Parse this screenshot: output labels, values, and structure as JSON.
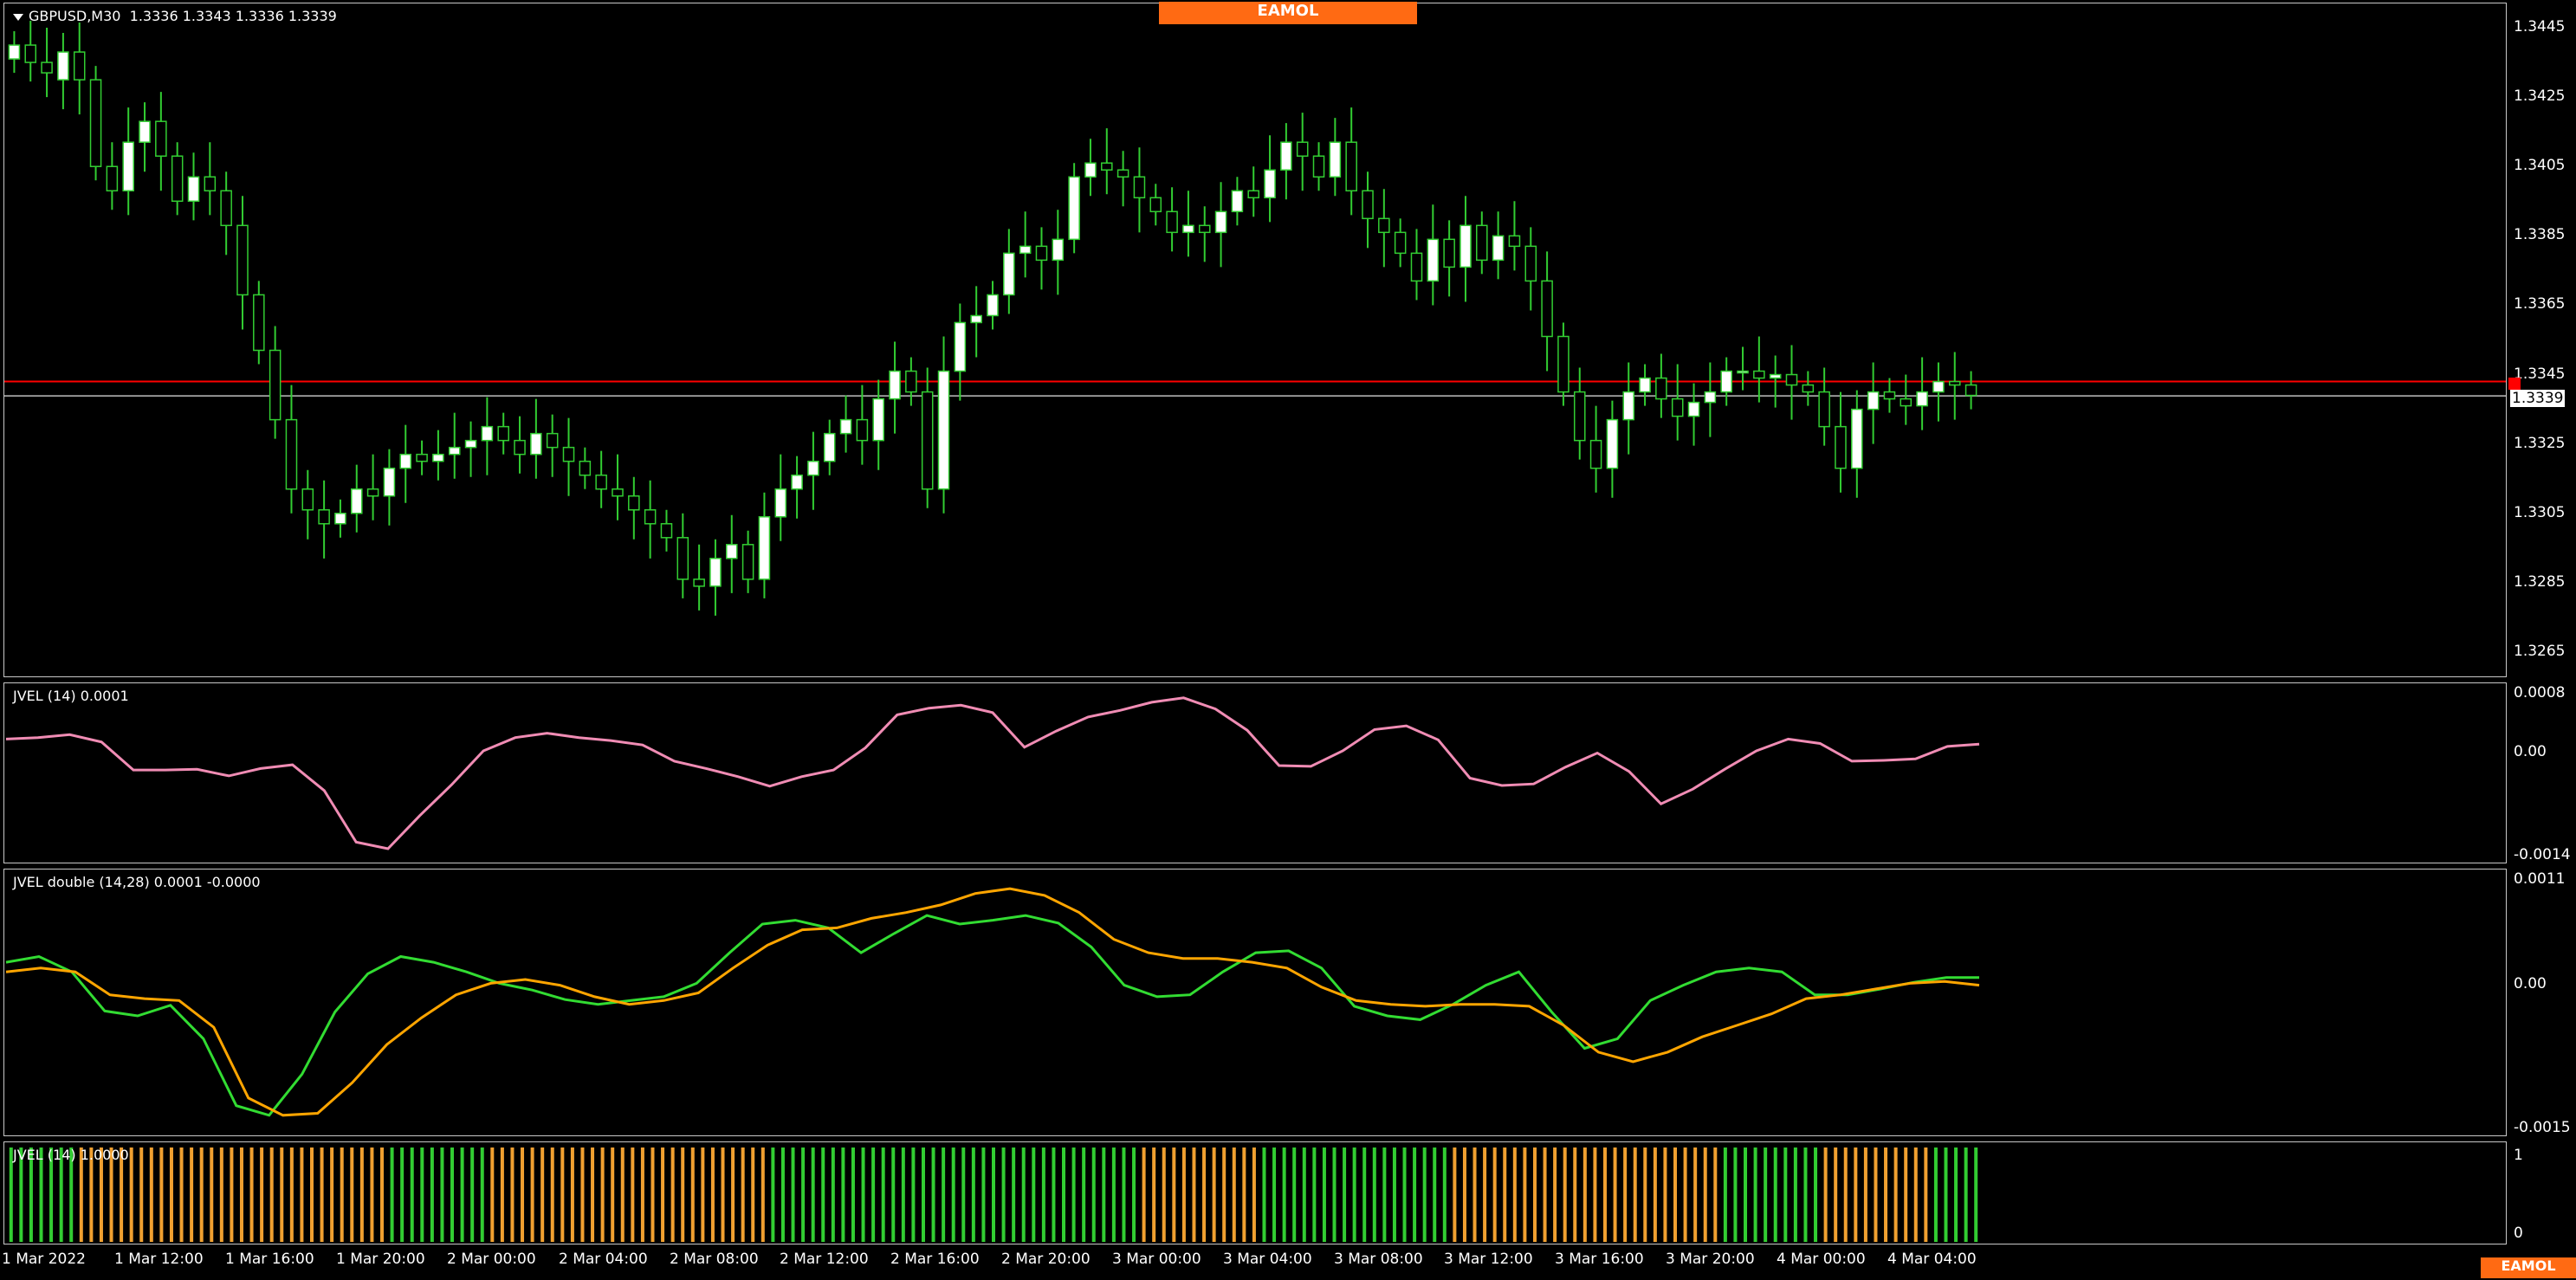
{
  "main": {
    "symbol_title": "GBPUSD,M30",
    "ohlc": "1.3336 1.3343 1.3336 1.3339",
    "price_scale": [
      "1.3445",
      "1.3425",
      "1.3405",
      "1.3385",
      "1.3365",
      "1.3345",
      "1.3325",
      "1.3305",
      "1.3285",
      "1.3265"
    ],
    "current_price": "1.3339",
    "candle_color": "#32cd32",
    "bull_fill": "#ffffff",
    "bear_fill": "#000000",
    "bid_line_color": "#c0c0c0",
    "ask_line_color": "#ff0000"
  },
  "logo_text": "EAMOL",
  "logo_text_2": "EAMOL",
  "ind1": {
    "title": "JVEL (14) 0.0001",
    "scale": [
      "0.0008",
      "0.00",
      "-0.0014"
    ],
    "color": "#f08cb4"
  },
  "ind2": {
    "title": "JVEL double (14,28) 0.0001 -0.0000",
    "scale": [
      "0.0011",
      "0.00",
      "-0.0015"
    ],
    "fast_color": "#32dc32",
    "slow_color": "#ffa500"
  },
  "ind3": {
    "title": "JVEL (14) 1.0000",
    "scale": [
      "1",
      "0"
    ],
    "up_color": "#32cd32",
    "down_color": "#f0a030"
  },
  "time_axis": [
    "1 Mar 2022",
    "1 Mar 12:00",
    "1 Mar 16:00",
    "1 Mar 20:00",
    "2 Mar 00:00",
    "2 Mar 04:00",
    "2 Mar 08:00",
    "2 Mar 12:00",
    "2 Mar 16:00",
    "2 Mar 20:00",
    "3 Mar 00:00",
    "3 Mar 04:00",
    "3 Mar 08:00",
    "3 Mar 12:00",
    "3 Mar 16:00",
    "3 Mar 20:00",
    "4 Mar 00:00",
    "4 Mar 04:00"
  ],
  "chart_data": [
    {
      "type": "candlestick",
      "title": "GBPUSD,M30",
      "ylim": [
        1.3258,
        1.3452
      ],
      "close_path": [
        1.344,
        1.3435,
        1.3432,
        1.3438,
        1.343,
        1.3405,
        1.3398,
        1.3412,
        1.3418,
        1.3408,
        1.3395,
        1.3402,
        1.3398,
        1.3388,
        1.3368,
        1.3352,
        1.3332,
        1.3312,
        1.3306,
        1.3302,
        1.3305,
        1.3312,
        1.331,
        1.3318,
        1.3322,
        1.332,
        1.3322,
        1.3324,
        1.3326,
        1.333,
        1.3326,
        1.3322,
        1.3328,
        1.3324,
        1.332,
        1.3316,
        1.3312,
        1.331,
        1.3306,
        1.3302,
        1.3298,
        1.3286,
        1.3284,
        1.3292,
        1.3296,
        1.3286,
        1.3304,
        1.3312,
        1.3316,
        1.332,
        1.3328,
        1.3332,
        1.3326,
        1.3338,
        1.3346,
        1.334,
        1.3312,
        1.3346,
        1.336,
        1.3362,
        1.3368,
        1.338,
        1.3382,
        1.3378,
        1.3384,
        1.3402,
        1.3406,
        1.3404,
        1.3402,
        1.3396,
        1.3392,
        1.3386,
        1.3388,
        1.3386,
        1.3392,
        1.3398,
        1.3396,
        1.3404,
        1.3412,
        1.3408,
        1.3402,
        1.3412,
        1.3398,
        1.339,
        1.3386,
        1.338,
        1.3372,
        1.3384,
        1.3376,
        1.3388,
        1.3378,
        1.3385,
        1.3382,
        1.3372,
        1.3356,
        1.334,
        1.3326,
        1.3318,
        1.3332,
        1.334,
        1.3344,
        1.3338,
        1.3333,
        1.3337,
        1.334,
        1.3346,
        1.3346,
        1.3344,
        1.3345,
        1.3342,
        1.334,
        1.333,
        1.3318,
        1.3335,
        1.334,
        1.3338,
        1.3336,
        1.334,
        1.3343,
        1.3342,
        1.3339
      ],
      "series": [
        {
          "name": "Open",
          "values": [
            1.3436,
            1.344,
            1.3435,
            1.343,
            1.3438,
            1.343,
            1.3405,
            1.3398,
            1.3412,
            1.3418,
            1.3408,
            1.3395,
            1.3402,
            1.3398,
            1.3388,
            1.3368,
            1.3352,
            1.3332,
            1.3312,
            1.3306,
            1.3302,
            1.3305,
            1.3312,
            1.331,
            1.3318,
            1.3322,
            1.332,
            1.3322,
            1.3324,
            1.3326,
            1.333,
            1.3326,
            1.3322,
            1.3328,
            1.3324,
            1.332,
            1.3316,
            1.3312,
            1.331,
            1.3306,
            1.3302,
            1.3298,
            1.3286,
            1.3284,
            1.3292,
            1.3296,
            1.3286,
            1.3304,
            1.3312,
            1.3316,
            1.332,
            1.3328,
            1.3332,
            1.3326,
            1.3338,
            1.3346,
            1.334,
            1.3312,
            1.3346,
            1.336,
            1.3362,
            1.3368,
            1.338,
            1.3382,
            1.3378,
            1.3384,
            1.3402,
            1.3406,
            1.3404,
            1.3402,
            1.3396,
            1.3392,
            1.3386,
            1.3388,
            1.3386,
            1.3392,
            1.3398,
            1.3396,
            1.3404,
            1.3412,
            1.3408,
            1.3402,
            1.3412,
            1.3398,
            1.339,
            1.3386,
            1.338,
            1.3372,
            1.3384,
            1.3376,
            1.3388,
            1.3378,
            1.3385,
            1.3382,
            1.3372,
            1.3356,
            1.334,
            1.3326,
            1.3318,
            1.3332,
            1.334,
            1.3344,
            1.3338,
            1.3333,
            1.3337,
            1.334,
            1.3346,
            1.3346,
            1.3344,
            1.3345,
            1.3342,
            1.334,
            1.333,
            1.3318,
            1.3335,
            1.334,
            1.3338,
            1.3336,
            1.334,
            1.3343,
            1.3342
          ]
        }
      ]
    },
    {
      "type": "line",
      "title": "JVEL (14) 0.0001",
      "ylim": [
        -0.0014,
        0.0008
      ],
      "series": [
        {
          "name": "JVEL (14)",
          "values": [
            0.00016,
            0.00018,
            0.00022,
            0.00012,
            -0.00026,
            -0.00026,
            -0.00025,
            -0.00034,
            -0.00024,
            -0.00019,
            -0.00054,
            -0.00124,
            -0.00133,
            -0.00088,
            -0.00046,
            0.0,
            0.00018,
            0.00024,
            0.00018,
            0.00014,
            8e-05,
            -0.00014,
            -0.00024,
            -0.00035,
            -0.00048,
            -0.00035,
            -0.00026,
            4e-05,
            0.00049,
            0.00058,
            0.00062,
            0.00052,
            5e-05,
            0.00027,
            0.00046,
            0.00055,
            0.00066,
            0.00072,
            0.00057,
            0.00028,
            -0.0002,
            -0.00021,
            0.0,
            0.00029,
            0.00034,
            0.00015,
            -0.00037,
            -0.00047,
            -0.00045,
            -0.00022,
            -3e-05,
            -0.00028,
            -0.00072,
            -0.00052,
            -0.00025,
            0.0,
            0.00016,
            0.0001,
            -0.00014,
            -0.00013,
            -0.00011,
            6e-05,
            9e-05
          ]
        }
      ]
    },
    {
      "type": "line",
      "title": "JVEL double (14,28) 0.0001 -0.0000",
      "ylim": [
        -0.0015,
        0.0011
      ],
      "series": [
        {
          "name": "Fast",
          "values": [
            0.00022,
            0.00028,
            0.00012,
            -0.00029,
            -0.00034,
            -0.00023,
            -0.00058,
            -0.00128,
            -0.00138,
            -0.00095,
            -0.0003,
            0.0001,
            0.00028,
            0.00022,
            0.00012,
            0.0,
            -7e-05,
            -0.00017,
            -0.00022,
            -0.00018,
            -0.00014,
            0.0,
            0.00032,
            0.00062,
            0.00066,
            0.00058,
            0.00032,
            0.00052,
            0.00071,
            0.00062,
            0.00066,
            0.00071,
            0.00063,
            0.00038,
            -2e-05,
            -0.00014,
            -0.00012,
            0.00012,
            0.00032,
            0.00034,
            0.00016,
            -0.00024,
            -0.00034,
            -0.00038,
            -0.00022,
            -2e-05,
            0.00012,
            -0.0003,
            -0.00068,
            -0.00058,
            -0.00018,
            -2e-05,
            0.00012,
            0.00016,
            0.00012,
            -0.00012,
            -0.00012,
            -6e-05,
            1e-05,
            6e-05,
            6e-05
          ]
        },
        {
          "name": "Slow",
          "values": [
            0.00012,
            0.00016,
            0.00012,
            -0.00012,
            -0.00016,
            -0.00018,
            -0.00046,
            -0.0012,
            -0.00138,
            -0.00136,
            -0.00104,
            -0.00064,
            -0.00036,
            -0.00012,
            0.0,
            4e-05,
            -2e-05,
            -0.00014,
            -0.00022,
            -0.00018,
            -0.0001,
            0.00016,
            0.0004,
            0.00056,
            0.00058,
            0.00068,
            0.00074,
            0.00082,
            0.00094,
            0.00099,
            0.00092,
            0.00074,
            0.00046,
            0.00032,
            0.00026,
            0.00026,
            0.00022,
            0.00016,
            -4e-05,
            -0.00018,
            -0.00022,
            -0.00024,
            -0.00022,
            -0.00022,
            -0.00024,
            -0.00044,
            -0.00072,
            -0.00082,
            -0.00072,
            -0.00056,
            -0.00044,
            -0.00032,
            -0.00016,
            -0.00012,
            -6e-05,
            0.0,
            2e-05,
            -2e-05
          ]
        }
      ]
    },
    {
      "type": "bar",
      "title": "JVEL (14) 1.0000",
      "ylim": [
        0,
        1
      ],
      "values": [
        1,
        1,
        1,
        1,
        1,
        1,
        1,
        0,
        0,
        0,
        0,
        0,
        0,
        0,
        0,
        0,
        0,
        0,
        0,
        0,
        0,
        0,
        0,
        0,
        0,
        0,
        0,
        0,
        0,
        0,
        0,
        0,
        0,
        0,
        0,
        0,
        0,
        0,
        1,
        1,
        1,
        1,
        1,
        1,
        1,
        1,
        1,
        1,
        0,
        0,
        0,
        0,
        0,
        0,
        0,
        0,
        0,
        0,
        0,
        0,
        0,
        0,
        0,
        0,
        0,
        0,
        0,
        0,
        0,
        0,
        0,
        0,
        0,
        0,
        0,
        0,
        1,
        1,
        1,
        1,
        1,
        1,
        1,
        1,
        1,
        1,
        1,
        1,
        1,
        1,
        1,
        1,
        1,
        1,
        1,
        1,
        1,
        1,
        1,
        1,
        1,
        1,
        1,
        1,
        1,
        1,
        1,
        1,
        1,
        1,
        1,
        1,
        1,
        0,
        0,
        0,
        0,
        0,
        0,
        0,
        0,
        0,
        0,
        0,
        0,
        1,
        1,
        1,
        1,
        1,
        1,
        1,
        1,
        1,
        1,
        1,
        1,
        1,
        1,
        1,
        1,
        1,
        1,
        1,
        0,
        0,
        0,
        0,
        0,
        0,
        0,
        0,
        0,
        0,
        0,
        0,
        0,
        0,
        0,
        0,
        0,
        0,
        0,
        0,
        0,
        0,
        0,
        0,
        0,
        0,
        0,
        1,
        1,
        1,
        1,
        1,
        1,
        1,
        1,
        1,
        1,
        0,
        0,
        0,
        0,
        0,
        0,
        0,
        0,
        0,
        0,
        0,
        1,
        1,
        1,
        1,
        1
      ]
    }
  ]
}
